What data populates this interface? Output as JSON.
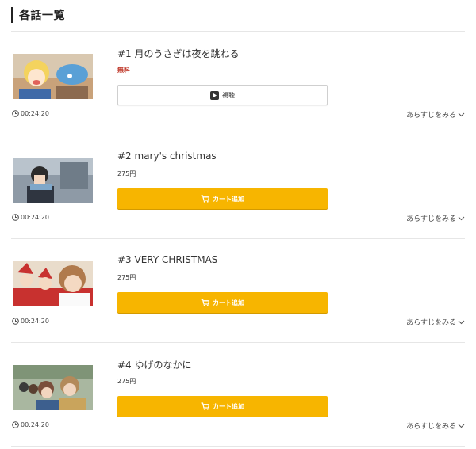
{
  "section": {
    "title": "各話一覧"
  },
  "episodes": [
    {
      "title": "#1 月のうさぎは夜を跳ねる",
      "price": "無料",
      "button_label": "視聴",
      "button_type": "watch",
      "duration": "00:24:20",
      "synopsis_link": "あらすじをみる"
    },
    {
      "title": "#2 mary's christmas",
      "price": "275円",
      "button_label": "カート追加",
      "button_type": "cart",
      "duration": "00:24:20",
      "synopsis_link": "あらすじをみる"
    },
    {
      "title": "#3 VERY CHRISTMAS",
      "price": "275円",
      "button_label": "カート追加",
      "button_type": "cart",
      "duration": "00:24:20",
      "synopsis_link": "あらすじをみる"
    },
    {
      "title": "#4 ゆげのなかに",
      "price": "275円",
      "button_label": "カート追加",
      "button_type": "cart",
      "duration": "00:24:20",
      "synopsis_link": "あらすじをみる"
    }
  ],
  "colors": {
    "cart_button": "#f7b500",
    "free_price": "#c0392b",
    "divider": "#e6e6e6"
  },
  "icons": {
    "watch": "play-icon",
    "cart": "cart-icon",
    "duration": "clock-icon",
    "synopsis": "chevron-down-icon"
  }
}
